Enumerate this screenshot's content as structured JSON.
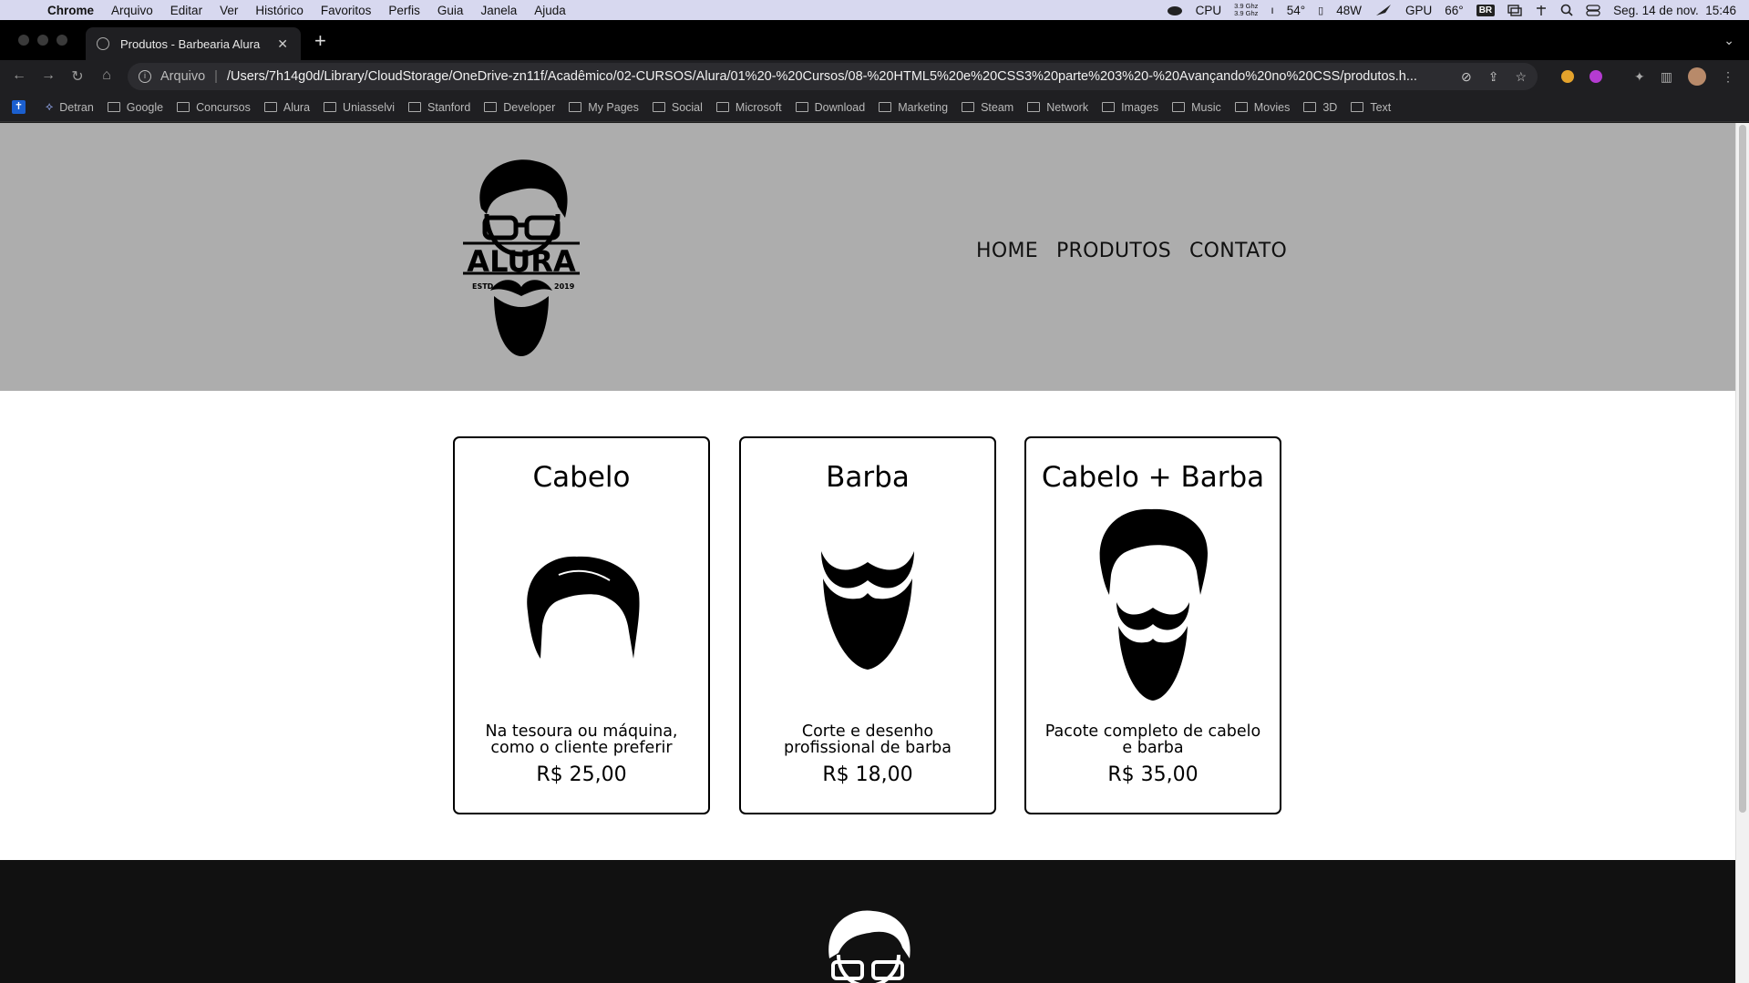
{
  "menubar": {
    "app": "Chrome",
    "items": [
      "Arquivo",
      "Editar",
      "Ver",
      "Histórico",
      "Favoritos",
      "Perfis",
      "Guia",
      "Janela",
      "Ajuda"
    ],
    "status": {
      "cpu_label": "CPU",
      "cpu_freq_1": "3.9 Ghz",
      "cpu_freq_2": "3.9 Ghz",
      "temp": "54°",
      "power": "48W",
      "gpu_label": "GPU",
      "gpu_temp": "66°",
      "input_source": "BR",
      "datetime": "Seg. 14 de nov.  15:46"
    }
  },
  "browser": {
    "tab_title": "Produtos - Barbearia Alura",
    "address_scheme": "Arquivo",
    "url": "/Users/7h14g0d/Library/CloudStorage/OneDrive-zn11f/Acadêmico/02-CURSOS/Alura/01%20-%20Cursos/08-%20HTML5%20e%20CSS3%20parte%203%20-%20Avançando%20no%20CSS/produtos.h..."
  },
  "bookmarks": [
    "Detran",
    "Google",
    "Concursos",
    "Alura",
    "Uniasselvi",
    "Stanford",
    "Developer",
    "My Pages",
    "Social",
    "Microsoft",
    "Download",
    "Marketing",
    "Steam",
    "Network",
    "Images",
    "Music",
    "Movies",
    "3D",
    "Text"
  ],
  "site": {
    "logo_text": "ALURA",
    "logo_estd": "ESTD",
    "logo_year": "2019",
    "nav": [
      "HOME",
      "PRODUTOS",
      "CONTATO"
    ],
    "products": [
      {
        "name": "Cabelo",
        "description": "Na tesoura ou máquina, como o cliente preferir",
        "price": "R$ 25,00"
      },
      {
        "name": "Barba",
        "description": "Corte e desenho profissional de barba",
        "price": "R$ 18,00"
      },
      {
        "name": "Cabelo + Barba",
        "description": "Pacote completo de cabelo e barba",
        "price": "R$ 35,00"
      }
    ]
  }
}
